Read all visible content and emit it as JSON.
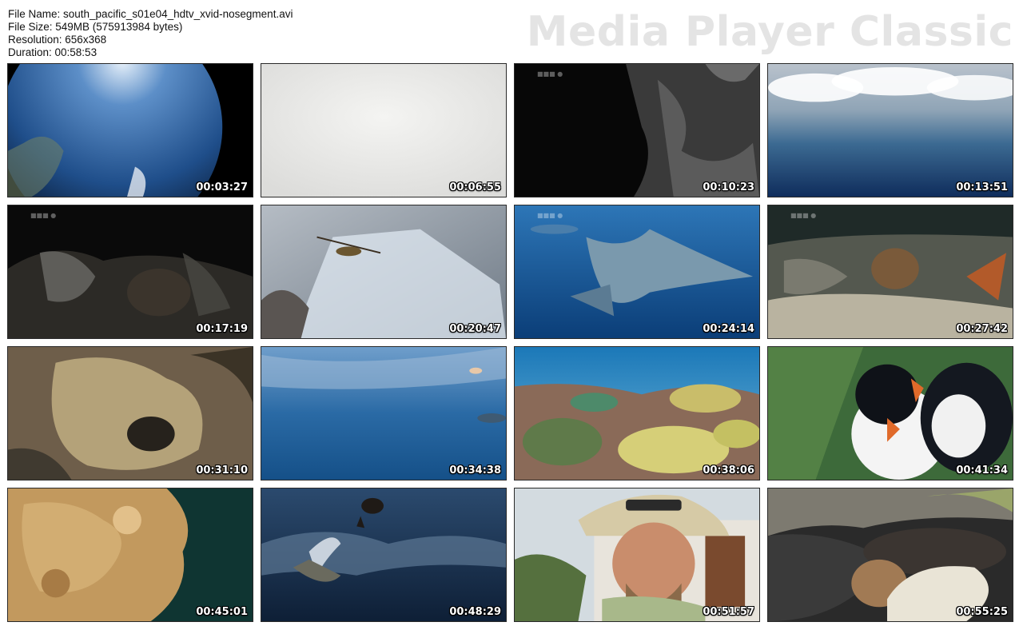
{
  "file_info": {
    "name_line": "File Name: south_pacific_s01e04_hdtv_xvid-nosegment.avi",
    "size_line": "File Size: 549MB (575913984 bytes)",
    "resolution_line": "Resolution: 656x368",
    "duration_line": "Duration: 00:58:53"
  },
  "watermark": "Media Player Classic",
  "thumbnails": [
    {
      "timestamp": "00:03:27",
      "scene": "earth-from-space"
    },
    {
      "timestamp": "00:06:55",
      "scene": "white-overexposed"
    },
    {
      "timestamp": "00:10:23",
      "scene": "dark-rock-crevice"
    },
    {
      "timestamp": "00:13:51",
      "scene": "clouds-over-ocean"
    },
    {
      "timestamp": "00:17:19",
      "scene": "rat-on-rocks-night"
    },
    {
      "timestamp": "00:20:47",
      "scene": "cricket-on-ice"
    },
    {
      "timestamp": "00:24:14",
      "scene": "shark-underwater"
    },
    {
      "timestamp": "00:27:42",
      "scene": "shell-on-reef"
    },
    {
      "timestamp": "00:31:10",
      "scene": "coral-closeup"
    },
    {
      "timestamp": "00:34:38",
      "scene": "fish-school-blue"
    },
    {
      "timestamp": "00:38:06",
      "scene": "coral-reef-colorful"
    },
    {
      "timestamp": "00:41:34",
      "scene": "two-birds"
    },
    {
      "timestamp": "00:45:01",
      "scene": "fan-coral"
    },
    {
      "timestamp": "00:48:29",
      "scene": "sea-lion-leaping-wave"
    },
    {
      "timestamp": "00:51:57",
      "scene": "man-in-hat"
    },
    {
      "timestamp": "00:55:25",
      "scene": "people-on-lava-rocks"
    }
  ]
}
